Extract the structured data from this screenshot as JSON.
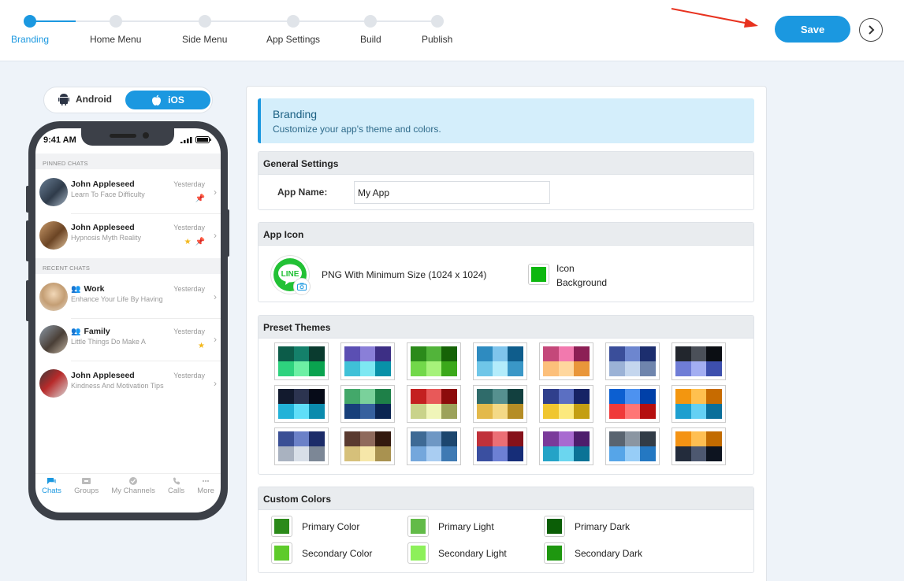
{
  "steps": [
    {
      "label": "Branding",
      "active": true
    },
    {
      "label": "Home Menu",
      "active": false
    },
    {
      "label": "Side Menu",
      "active": false
    },
    {
      "label": "App Settings",
      "active": false
    },
    {
      "label": "Build",
      "active": false
    },
    {
      "label": "Publish",
      "active": false
    }
  ],
  "toolbar": {
    "save_label": "Save"
  },
  "platform": {
    "android_label": "Android",
    "ios_label": "iOS",
    "selected": "iOS"
  },
  "phone": {
    "time": "9:41 AM",
    "pinned_header": "PINNED CHATS",
    "recent_header": "RECENT CHATS",
    "chats": [
      {
        "name": "John Appleseed",
        "message": "Learn To Face Difficulty",
        "time": "Yesterday",
        "group": false,
        "star": false,
        "pin": true
      },
      {
        "name": "John Appleseed",
        "message": "Hypnosis Myth Reality",
        "time": "Yesterday",
        "group": false,
        "star": true,
        "pin": true
      },
      {
        "name": "Work",
        "message": "Enhance Your Life By Having",
        "time": "Yesterday",
        "group": true,
        "star": false,
        "pin": false
      },
      {
        "name": "Family",
        "message": "Little Things Do Make A",
        "time": "Yesterday",
        "group": true,
        "star": true,
        "pin": false
      },
      {
        "name": "John Appleseed",
        "message": "Kindness And Motivation Tips",
        "time": "Yesterday",
        "group": false,
        "star": false,
        "pin": false
      }
    ],
    "tabs": [
      {
        "label": "Chats",
        "active": true
      },
      {
        "label": "Groups",
        "active": false
      },
      {
        "label": "My Channels",
        "active": false
      },
      {
        "label": "Calls",
        "active": false
      },
      {
        "label": "More",
        "active": false
      }
    ]
  },
  "banner": {
    "title": "Branding",
    "subtitle": "Customize your app's theme and colors."
  },
  "general": {
    "header": "General Settings",
    "app_name_label": "App Name:",
    "app_name_value": "My App"
  },
  "app_icon": {
    "header": "App Icon",
    "logo_text": "LINE",
    "requirement": "PNG With Minimum Size (1024 x 1024)",
    "bg_label_1": "Icon",
    "bg_label_2": "Background",
    "bg_color": "#0db70f"
  },
  "preset_themes": {
    "header": "Preset Themes",
    "themes": [
      [
        "#0c5c49",
        "#14806a",
        "#0a3b2f",
        "#2ed27e",
        "#6cf0a4",
        "#0aa34f"
      ],
      [
        "#5b4fb3",
        "#8a7fd8",
        "#3d2f85",
        "#3fc1d7",
        "#7de8f2",
        "#0891a8"
      ],
      [
        "#2b8a1a",
        "#52b43a",
        "#166307",
        "#72d84a",
        "#a6f27a",
        "#3ba81a"
      ],
      [
        "#2e8bc0",
        "#7fc4ec",
        "#0f5d8c",
        "#6fc6e8",
        "#b3ecfb",
        "#3a97c7"
      ],
      [
        "#c4487a",
        "#f279ae",
        "#8c1f55",
        "#fcbf7a",
        "#ffd79e",
        "#e9963a"
      ],
      [
        "#3a4e9a",
        "#6d86cf",
        "#1c2e6e",
        "#9bb2d6",
        "#c4d6ee",
        "#6f85ad"
      ],
      [
        "#22262d",
        "#4b5059",
        "#0b0e13",
        "#6f7dd6",
        "#a3aef2",
        "#3d4fad"
      ],
      [
        "#121a2e",
        "#2c3450",
        "#060b18",
        "#22b2d8",
        "#5fdef8",
        "#0b8bad"
      ],
      [
        "#43a86a",
        "#7ad19b",
        "#1e8048",
        "#173f7a",
        "#36609e",
        "#0b2552"
      ],
      [
        "#c42020",
        "#e85959",
        "#8c0b0b",
        "#c9d38a",
        "#f0f5b9",
        "#9ca25a"
      ],
      [
        "#2f6b6a",
        "#56908f",
        "#12403f",
        "#e3b94b",
        "#f4d986",
        "#b58d25"
      ],
      [
        "#2f3f8c",
        "#5b6fc2",
        "#162365",
        "#f0c62f",
        "#fce97e",
        "#c49f12"
      ],
      [
        "#0c5fd1",
        "#4d92f0",
        "#0040a8",
        "#f03a3a",
        "#ff7676",
        "#b50f0f"
      ],
      [
        "#f3960f",
        "#ffc04f",
        "#c76b00",
        "#1e9fcf",
        "#64d0f4",
        "#0b6f9a"
      ],
      [
        "#3a4f95",
        "#6b81c8",
        "#1c2c69",
        "#a9b2c0",
        "#d8dfe8",
        "#7c8796"
      ],
      [
        "#5a3a2f",
        "#8f6a5c",
        "#33190f",
        "#d6c07a",
        "#f6e7a9",
        "#a99250"
      ],
      [
        "#3e6a95",
        "#6e97c4",
        "#1c466e",
        "#74a7dc",
        "#a9cdf2",
        "#3f7ab3"
      ],
      [
        "#c0313a",
        "#eb6f75",
        "#86111a",
        "#3a4fa0",
        "#6d80d4",
        "#162d78"
      ],
      [
        "#7a3a9a",
        "#a86ad0",
        "#4d1d6c",
        "#24a3c7",
        "#6bd6ef",
        "#0b7396"
      ],
      [
        "#596470",
        "#8b96a2",
        "#323c47",
        "#56a5e8",
        "#97cdf7",
        "#2478c2"
      ],
      [
        "#f49314",
        "#ffbf52",
        "#c26b00",
        "#232c3c",
        "#4d5870",
        "#0d1420"
      ]
    ]
  },
  "custom_colors": {
    "header": "Custom Colors",
    "items": [
      {
        "label": "Primary Color",
        "color": "#2b8a1a"
      },
      {
        "label": "Primary Light",
        "color": "#62bb48"
      },
      {
        "label": "Primary Dark",
        "color": "#0b5e06"
      },
      {
        "label": "Secondary Color",
        "color": "#5ecb2b"
      },
      {
        "label": "Secondary Light",
        "color": "#8df05a"
      },
      {
        "label": "Secondary Dark",
        "color": "#1e970f"
      }
    ]
  }
}
